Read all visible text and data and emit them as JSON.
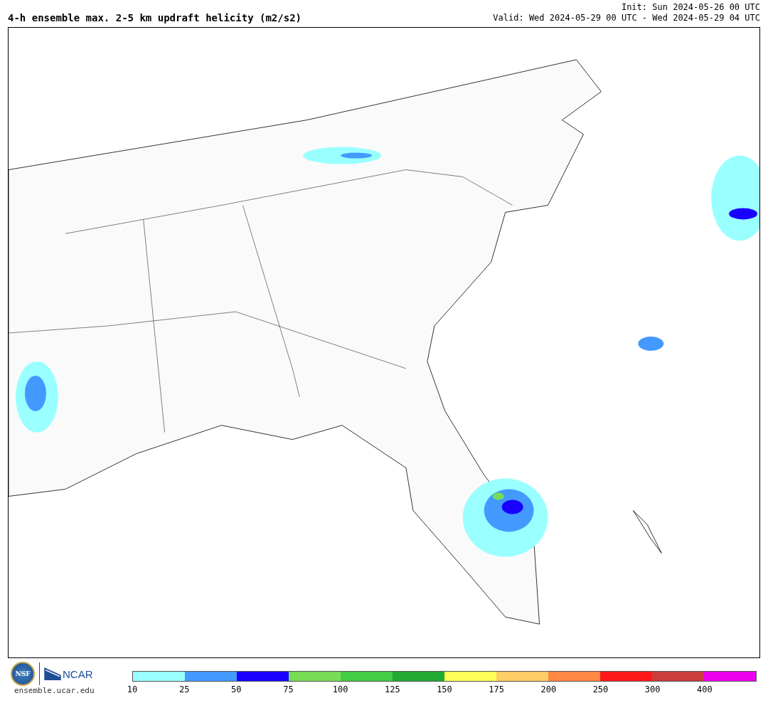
{
  "header": {
    "title": "4-h ensemble max. 2-5 km updraft helicity (m2/s2)",
    "init": "Init: Sun 2024-05-26 00 UTC",
    "valid": "Valid: Wed 2024-05-29 00 UTC - Wed 2024-05-29 04 UTC"
  },
  "footer": {
    "nsf_logo": "NSF",
    "ncar_logo": "NCAR",
    "site": "ensemble.ucar.edu"
  },
  "colorbar": [
    {
      "label": "10",
      "color": "#99ffff"
    },
    {
      "label": "25",
      "color": "#4499ff"
    },
    {
      "label": "50",
      "color": "#1a00ff"
    },
    {
      "label": "75",
      "color": "#77dd55"
    },
    {
      "label": "100",
      "color": "#44cc44"
    },
    {
      "label": "125",
      "color": "#22aa33"
    },
    {
      "label": "150",
      "color": "#ffff55"
    },
    {
      "label": "175",
      "color": "#ffcc66"
    },
    {
      "label": "200",
      "color": "#ff8844"
    },
    {
      "label": "250",
      "color": "#ff1a1a"
    },
    {
      "label": "300",
      "color": "#cc3d3d"
    },
    {
      "label": "400",
      "color": "#ee00ee"
    }
  ]
}
